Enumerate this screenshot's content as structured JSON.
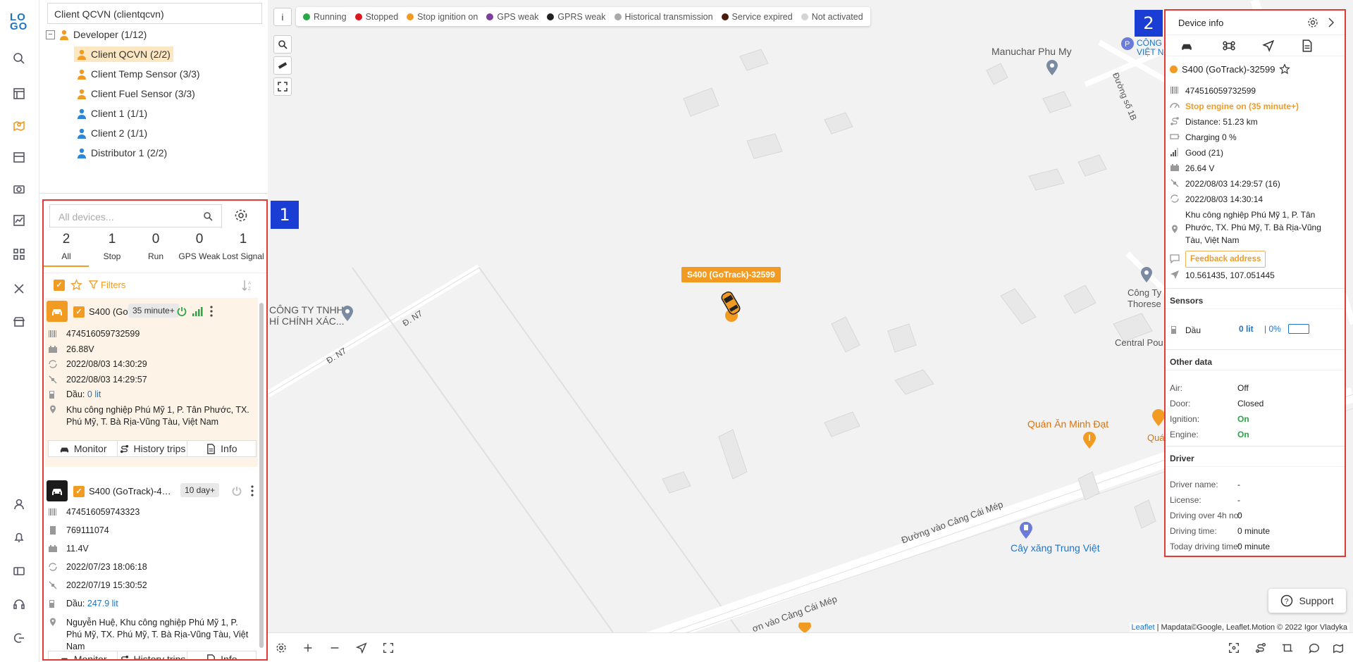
{
  "nav": {
    "logo_l1": "LO",
    "logo_l2": "GO"
  },
  "tree": {
    "client_selector": "Client QCVN (clientqcvn)",
    "toggle": "−",
    "nodes": [
      {
        "label": "Developer (1/12)"
      },
      {
        "label": "Client QCVN (2/2)"
      },
      {
        "label": "Client Temp Sensor (3/3)"
      },
      {
        "label": "Client Fuel Sensor (3/3)"
      },
      {
        "label": "Client 1 (1/1)"
      },
      {
        "label": "Client 2 (1/1)"
      },
      {
        "label": "Distributor 1 (2/2)"
      }
    ]
  },
  "devices_panel": {
    "search_placeholder": "All devices...",
    "counts": [
      {
        "n": "2",
        "label": "All"
      },
      {
        "n": "1",
        "label": "Stop"
      },
      {
        "n": "0",
        "label": "Run"
      },
      {
        "n": "0",
        "label": "GPS Weak"
      },
      {
        "n": "1",
        "label": "Lost Signal"
      }
    ],
    "filters_label": "Filters",
    "devices": [
      {
        "name": "S400 (GoT...",
        "badge": "35 minute+",
        "imei": "474516059732599",
        "voltage": "26.88V",
        "time1": "2022/08/03 14:30:29",
        "time2": "2022/08/03 14:29:57",
        "fuel_label": "Dầu:",
        "fuel_value": "0 lit",
        "address": "Khu công nghiệp Phú Mỹ 1, P. Tân Phước, TX. Phú Mỹ, T. Bà Rịa-Vũng Tàu, Việt Nam"
      },
      {
        "name": "S400 (GoTrack)-43...",
        "badge": "10 day+",
        "imei": "474516059743323",
        "phone": "769111074",
        "voltage": "11.4V",
        "time1": "2022/07/23 18:06:18",
        "time2": "2022/07/19 15:30:52",
        "fuel_label": "Dầu:",
        "fuel_value": "247.9 lit",
        "address": "Nguyễn Huệ, Khu công nghiệp Phú Mỹ 1, P. Phú Mỹ, TX. Phú Mỹ, T. Bà Rịa-Vũng Tàu, Việt Nam"
      }
    ],
    "actions": {
      "monitor": "Monitor",
      "history": "History trips",
      "info": "Info"
    }
  },
  "legend": [
    {
      "label": "Running",
      "color": "#28a745"
    },
    {
      "label": "Stopped",
      "color": "#e0171e"
    },
    {
      "label": "Stop ignition on",
      "color": "#f29b22"
    },
    {
      "label": "GPS weak",
      "color": "#7a3f9a"
    },
    {
      "label": "GPRS weak",
      "color": "#222222"
    },
    {
      "label": "Historical transmission",
      "color": "#aaaaaa"
    },
    {
      "label": "Service expired",
      "color": "#4a1a0a"
    },
    {
      "label": "Not activated",
      "color": "#d4d4d4"
    }
  ],
  "map": {
    "info_btn": "i",
    "vehicle_label": "S400 (GoTrack)-32599",
    "pois": {
      "manuchar": "Manuchar Phu My",
      "cong_ty_tnhh": "CÔNG TY TNHH",
      "hi_chinh": "HÍ CHÍNH XÁC...",
      "d_n7_a": "Đ. N7",
      "d_n7_b": "Đ. N7",
      "duong_so": "Đường số 1B",
      "quan_an": "Quán Ăn Minh Đạt",
      "cay_xang": "Cây xăng Trung Việt",
      "duong_vao_1": "Đường vào Cảng Cái Mép",
      "duong_vao_2": "ơn vào Cảng Cái Mép",
      "cong_ty_r": "Công Ty",
      "thores": "Thorese",
      "central": "Central Pou",
      "cong_top": "CÔNG",
      "viet_n": "VIỆT N",
      "qua": "Quá"
    },
    "attribution_leaflet": "Leaflet",
    "attribution_rest": "| Mapdata©Google, Leaflet.Motion © 2022 Igor Vladyka",
    "support_label": "Support"
  },
  "device_info": {
    "title": "Device info",
    "name": "S400 (GoTrack)-32599",
    "rows": {
      "imei": "474516059732599",
      "status": "Stop engine on  (35 minute+)",
      "distance": "Distance: 51.23 km",
      "charging": "Charging 0 %",
      "signal": "Good (21)",
      "voltage": "26.64 V",
      "gps_time": "2022/08/03 14:29:57 (16)",
      "update_time": "2022/08/03 14:30:14",
      "address": "Khu công nghiệp Phú Mỹ 1, P. Tân Phước, TX. Phú Mỹ, T. Bà Rịa-Vũng Tàu, Việt Nam",
      "feedback": "Feedback address",
      "coords": "10.561435, 107.051445"
    },
    "sensors_title": "Sensors",
    "sensor": {
      "name": "Dầu",
      "value": "0 lit",
      "percent": "| 0%"
    },
    "other_title": "Other data",
    "other": [
      {
        "k": "Air:",
        "v": "Off"
      },
      {
        "k": "Door:",
        "v": "Closed"
      },
      {
        "k": "Ignition:",
        "v": "On"
      },
      {
        "k": "Engine:",
        "v": "On"
      }
    ],
    "driver_title": "Driver",
    "driver": [
      {
        "k": "Driver name:",
        "v": "-"
      },
      {
        "k": "License:",
        "v": "-"
      },
      {
        "k": "Driving over 4h no:",
        "v": "0"
      },
      {
        "k": "Driving time:",
        "v": "0 minute"
      },
      {
        "k": "Today driving time:",
        "v": "0 minute"
      }
    ]
  },
  "annotations": {
    "tag1": "1",
    "tag2": "2"
  }
}
